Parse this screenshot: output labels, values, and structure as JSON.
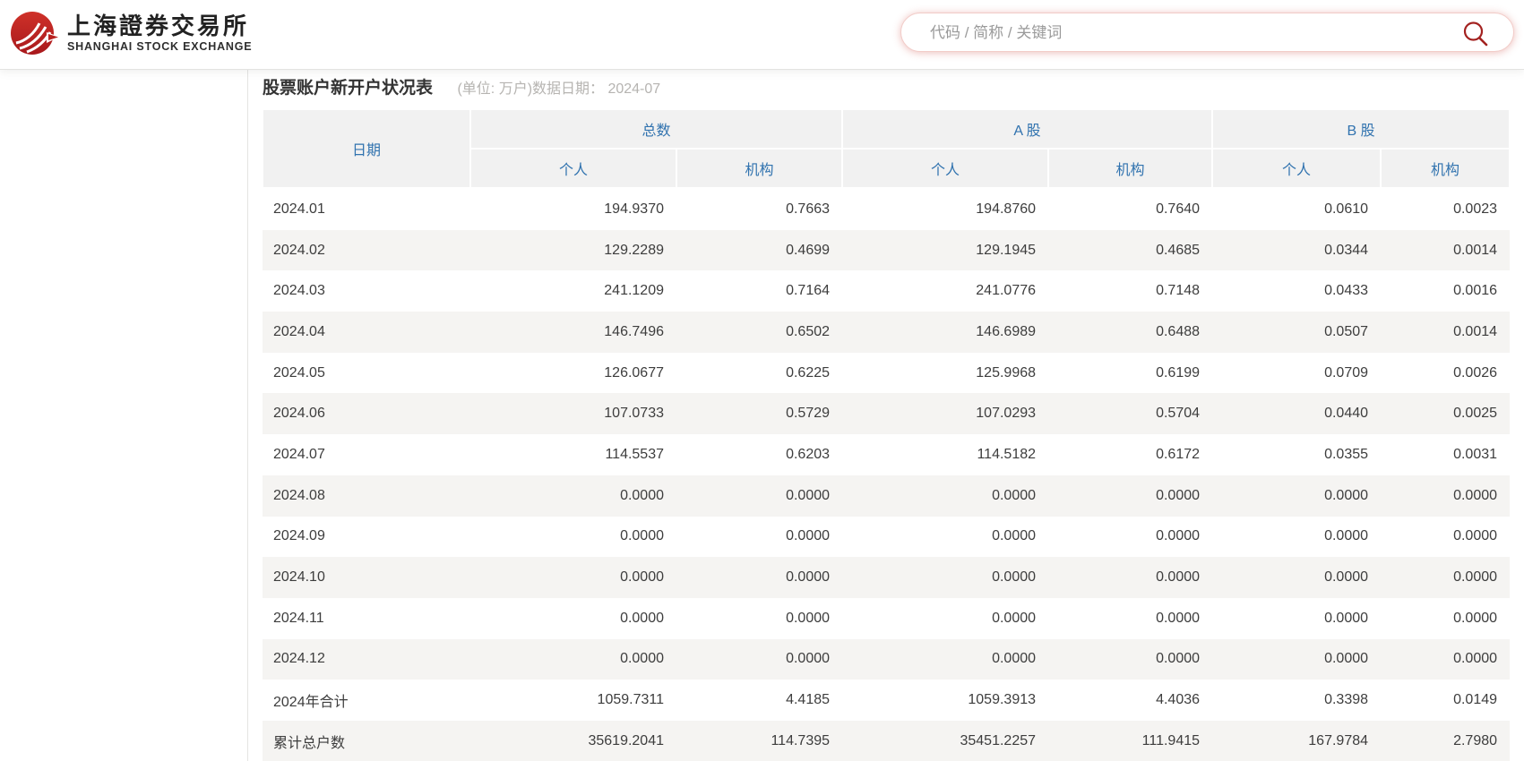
{
  "colors": {
    "brand_red": "#b8211f",
    "header_link_blue": "#3173af",
    "row_stripe": "#f5f4f2",
    "header_cell_bg": "#f1f1f1",
    "search_glow": "#d66e68"
  },
  "header": {
    "logo": {
      "name_cn": "上海證券交易所",
      "name_en": "SHANGHAI STOCK EXCHANGE"
    },
    "search": {
      "placeholder": "代码 / 简称 / 关键词",
      "value": ""
    }
  },
  "table": {
    "title": "股票账户新开户状况表",
    "subtitle": "(单位: 万户)数据日期：  2024-07",
    "header": {
      "date": "日期",
      "groups": [
        "总数",
        "A 股",
        "B 股"
      ],
      "subcolumns": [
        "个人",
        "机构",
        "个人",
        "机构",
        "个人",
        "机构"
      ]
    },
    "rows": [
      {
        "label": "2024.01",
        "values": [
          "194.9370",
          "0.7663",
          "194.8760",
          "0.7640",
          "0.0610",
          "0.0023"
        ]
      },
      {
        "label": "2024.02",
        "values": [
          "129.2289",
          "0.4699",
          "129.1945",
          "0.4685",
          "0.0344",
          "0.0014"
        ]
      },
      {
        "label": "2024.03",
        "values": [
          "241.1209",
          "0.7164",
          "241.0776",
          "0.7148",
          "0.0433",
          "0.0016"
        ]
      },
      {
        "label": "2024.04",
        "values": [
          "146.7496",
          "0.6502",
          "146.6989",
          "0.6488",
          "0.0507",
          "0.0014"
        ]
      },
      {
        "label": "2024.05",
        "values": [
          "126.0677",
          "0.6225",
          "125.9968",
          "0.6199",
          "0.0709",
          "0.0026"
        ]
      },
      {
        "label": "2024.06",
        "values": [
          "107.0733",
          "0.5729",
          "107.0293",
          "0.5704",
          "0.0440",
          "0.0025"
        ]
      },
      {
        "label": "2024.07",
        "values": [
          "114.5537",
          "0.6203",
          "114.5182",
          "0.6172",
          "0.0355",
          "0.0031"
        ]
      },
      {
        "label": "2024.08",
        "values": [
          "0.0000",
          "0.0000",
          "0.0000",
          "0.0000",
          "0.0000",
          "0.0000"
        ]
      },
      {
        "label": "2024.09",
        "values": [
          "0.0000",
          "0.0000",
          "0.0000",
          "0.0000",
          "0.0000",
          "0.0000"
        ]
      },
      {
        "label": "2024.10",
        "values": [
          "0.0000",
          "0.0000",
          "0.0000",
          "0.0000",
          "0.0000",
          "0.0000"
        ]
      },
      {
        "label": "2024.11",
        "values": [
          "0.0000",
          "0.0000",
          "0.0000",
          "0.0000",
          "0.0000",
          "0.0000"
        ]
      },
      {
        "label": "2024.12",
        "values": [
          "0.0000",
          "0.0000",
          "0.0000",
          "0.0000",
          "0.0000",
          "0.0000"
        ]
      },
      {
        "label": "2024年合计",
        "values": [
          "1059.7311",
          "4.4185",
          "1059.3913",
          "4.4036",
          "0.3398",
          "0.0149"
        ]
      },
      {
        "label": "累计总户数",
        "values": [
          "35619.2041",
          "114.7395",
          "35451.2257",
          "111.9415",
          "167.9784",
          "2.7980"
        ]
      }
    ]
  }
}
